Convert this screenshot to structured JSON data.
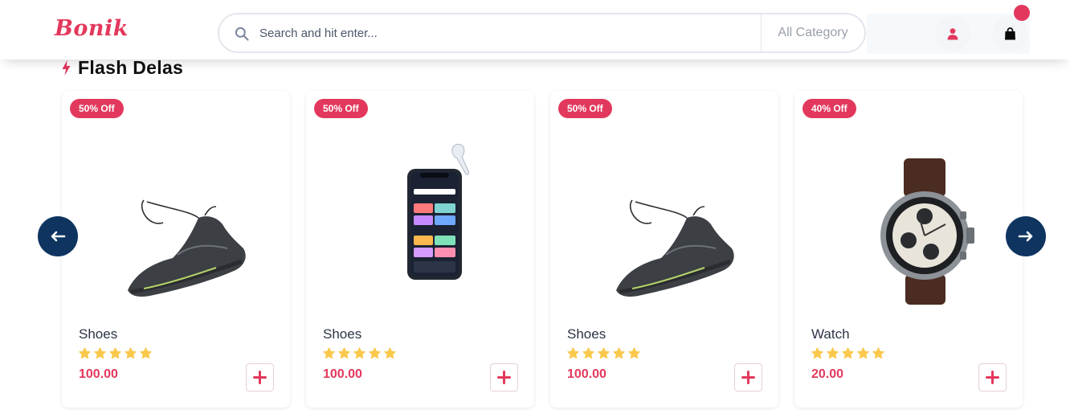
{
  "header": {
    "logo": "Bonik",
    "search": {
      "placeholder": "Search and hit enter...",
      "category": "All Category"
    },
    "icons": {
      "search": "search-icon",
      "user": "user-icon",
      "bag": "shopping-bag-icon"
    },
    "colors": {
      "brand": "#e3385d",
      "navy": "#0f3460",
      "star": "#fac94c"
    }
  },
  "section": {
    "title": "Flash Delas",
    "icon": "flash-icon"
  },
  "products": [
    {
      "discount": "50% Off",
      "name": "Shoes",
      "rating": 5,
      "price": "100.00",
      "image": "sneaker"
    },
    {
      "discount": "50% Off",
      "name": "Shoes",
      "rating": 5,
      "price": "100.00",
      "image": "smartphone"
    },
    {
      "discount": "50% Off",
      "name": "Shoes",
      "rating": 5,
      "price": "100.00",
      "image": "sneaker"
    },
    {
      "discount": "40% Off",
      "name": "Watch",
      "rating": 5,
      "price": "20.00",
      "image": "watch"
    }
  ],
  "carousel": {
    "prev_icon": "arrow-left-icon",
    "next_icon": "arrow-right-icon"
  }
}
